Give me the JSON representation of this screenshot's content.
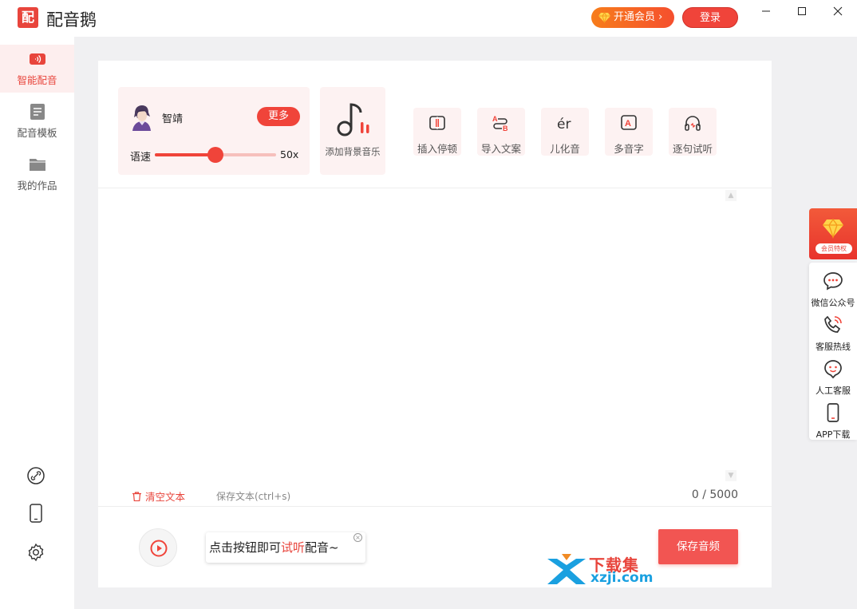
{
  "app": {
    "title": "配音鹅",
    "logo_text": "配",
    "vip_button": "开通会员",
    "login_button": "登录"
  },
  "sidebar": {
    "items": [
      {
        "label": "智能配音",
        "icon": "speaker-icon",
        "active": true
      },
      {
        "label": "配音模板",
        "icon": "template-icon",
        "active": false
      },
      {
        "label": "我的作品",
        "icon": "folder-icon",
        "active": false
      }
    ],
    "bottom_icons": [
      "link-icon",
      "phone-icon",
      "settings-icon"
    ]
  },
  "voice": {
    "name": "智靖",
    "more_button": "更多",
    "speed_label": "语速",
    "speed_value": "50x",
    "speed_fraction": 0.5
  },
  "bgm": {
    "label": "添加背景音乐"
  },
  "tools": [
    {
      "label": "插入停顿",
      "icon": "pause-insert-icon"
    },
    {
      "label": "导入文案",
      "icon": "import-text-icon"
    },
    {
      "label": "儿化音",
      "icon": "erhua-icon",
      "glyph": "ér"
    },
    {
      "label": "多音字",
      "icon": "polyphone-icon",
      "glyph": "A"
    },
    {
      "label": "逐句试听",
      "icon": "headphones-icon"
    }
  ],
  "editor": {
    "clear_text": "清空文本",
    "save_text": "保存文本(ctrl+s)",
    "char_count": "0 / 5000"
  },
  "bottom": {
    "tip_prefix": "点击按钮即可",
    "tip_highlight": "试听",
    "tip_suffix": "配音~",
    "save_audio": "保存音频"
  },
  "watermark": {
    "cn": "下载集",
    "en": "xzji.com"
  },
  "float_panel": {
    "vip_label": "会员特权",
    "services": [
      {
        "label": "微信公众号",
        "icon": "chat-bubble-icon"
      },
      {
        "label": "客服热线",
        "icon": "phone-call-icon"
      },
      {
        "label": "人工客服",
        "icon": "support-face-icon"
      },
      {
        "label": "APP下载",
        "icon": "mobile-icon"
      }
    ]
  },
  "colors": {
    "accent": "#f0443a",
    "accent_light": "#fdf2f2",
    "vip_gradient_start": "#f77d1b"
  }
}
